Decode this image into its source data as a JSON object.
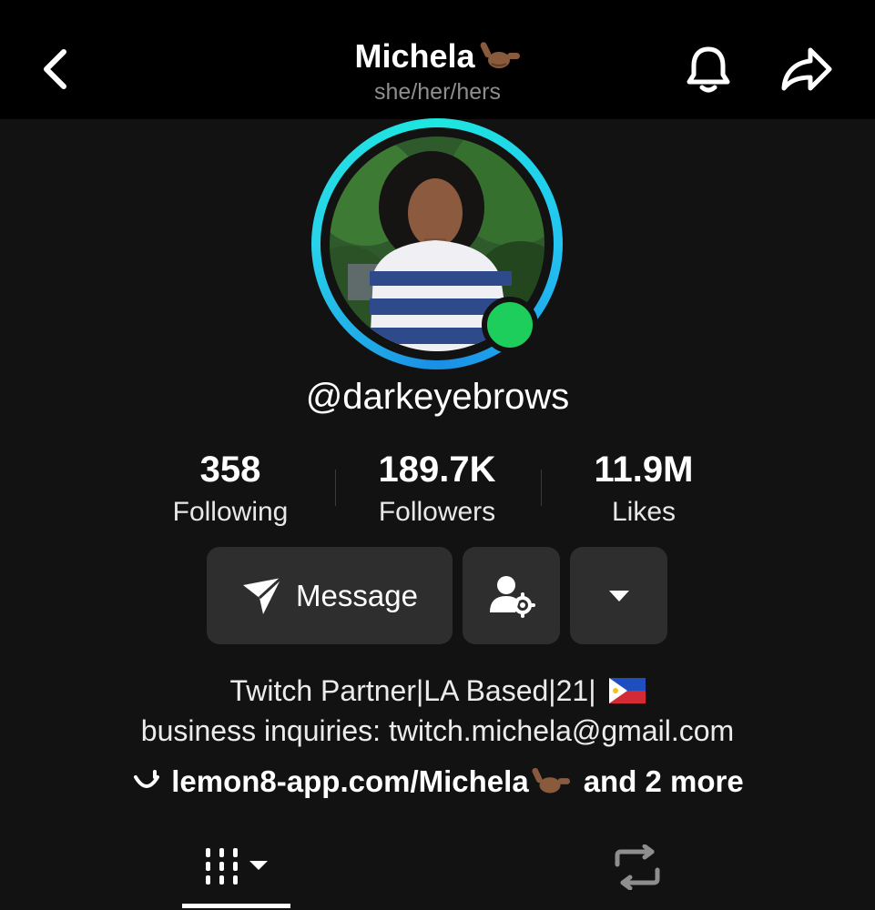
{
  "header": {
    "title": "Michela",
    "pronouns": "she/her/hers",
    "title_emoji_icon": "call-me-hand-emoji"
  },
  "profile": {
    "username": "@darkeyebrows",
    "ring_color": "#23c4f2",
    "live_dot_color": "#1ece5c"
  },
  "stats": [
    {
      "value": "358",
      "label": "Following"
    },
    {
      "value": "189.7K",
      "label": "Followers"
    },
    {
      "value": "11.9M",
      "label": "Likes"
    }
  ],
  "actions": {
    "message_label": "Message",
    "friend_icon": "user-settings-icon",
    "more_icon": "caret-down-icon"
  },
  "bio": {
    "line1": "Twitch Partner|LA Based|21|",
    "line2": "business inquiries: twitch.michela@gmail.com",
    "flag_icon": "philippines-flag"
  },
  "link": {
    "icon": "lemon8-smile-icon",
    "text": "lemon8-app.com/Michela",
    "more": "and 2 more"
  },
  "tabs": [
    {
      "icon": "videos-grid-icon",
      "active": true
    },
    {
      "icon": "repost-icon",
      "active": false
    }
  ]
}
